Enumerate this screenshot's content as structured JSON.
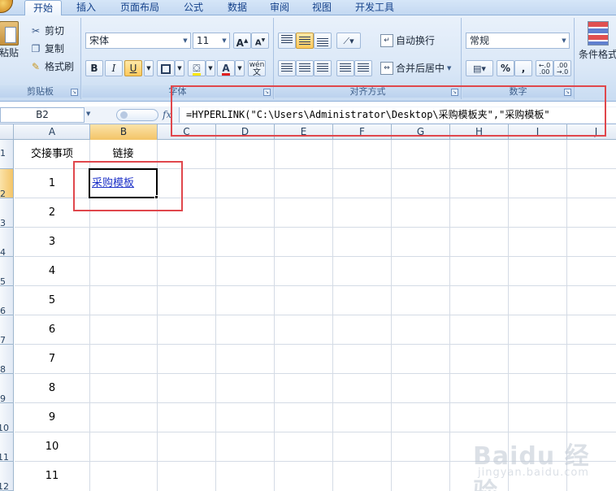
{
  "tabs": [
    {
      "label": "开始",
      "active": true
    },
    {
      "label": "插入",
      "active": false
    },
    {
      "label": "页面布局",
      "active": false
    },
    {
      "label": "公式",
      "active": false
    },
    {
      "label": "数据",
      "active": false
    },
    {
      "label": "审阅",
      "active": false
    },
    {
      "label": "视图",
      "active": false
    },
    {
      "label": "开发工具",
      "active": false
    }
  ],
  "ribbon": {
    "clipboard": {
      "paste_label": "粘贴",
      "cut_label": "剪切",
      "copy_label": "复制",
      "format_painter_label": "格式刷",
      "group_label": "剪贴板"
    },
    "font": {
      "font_name": "宋体",
      "font_size": "11",
      "bold": "B",
      "italic": "I",
      "underline": "U",
      "grow_font": "A",
      "shrink_font": "A",
      "font_color_glyph": "A",
      "phonetic_glyph": "wén",
      "group_label": "字体"
    },
    "alignment": {
      "wrap_text_label": "自动换行",
      "merge_center_label": "合并后居中",
      "group_label": "对齐方式"
    },
    "number": {
      "format_value": "常规",
      "percent": "%",
      "comma": ",",
      "group_label": "数字"
    },
    "styles": {
      "conditional_format_label": "条件格式"
    }
  },
  "formula_bar": {
    "name_box": "B2",
    "fx": "fx",
    "formula": "=HYPERLINK(\"C:\\Users\\Administrator\\Desktop\\采购模板夹\",\"采购模板\""
  },
  "columns": [
    "A",
    "B",
    "C",
    "D",
    "E",
    "F",
    "G",
    "H",
    "I",
    "J"
  ],
  "selected_column": "B",
  "rows": [
    "1",
    "2",
    "3",
    "4",
    "5",
    "6",
    "7",
    "8",
    "9",
    "10",
    "11",
    "12"
  ],
  "selected_row": "2",
  "cells": {
    "a1": "交接事项",
    "b1": "链接",
    "b2": "采购模板",
    "a_values": [
      "1",
      "2",
      "3",
      "4",
      "5",
      "6",
      "7",
      "8",
      "9",
      "10",
      "11"
    ]
  },
  "watermark": {
    "main": "Baidu 经验",
    "sub": "jingyan.baidu.com"
  },
  "colors": {
    "highlight_box": "#e0474c",
    "hyperlink": "#1f33c8",
    "ribbon_text": "#15428b"
  }
}
